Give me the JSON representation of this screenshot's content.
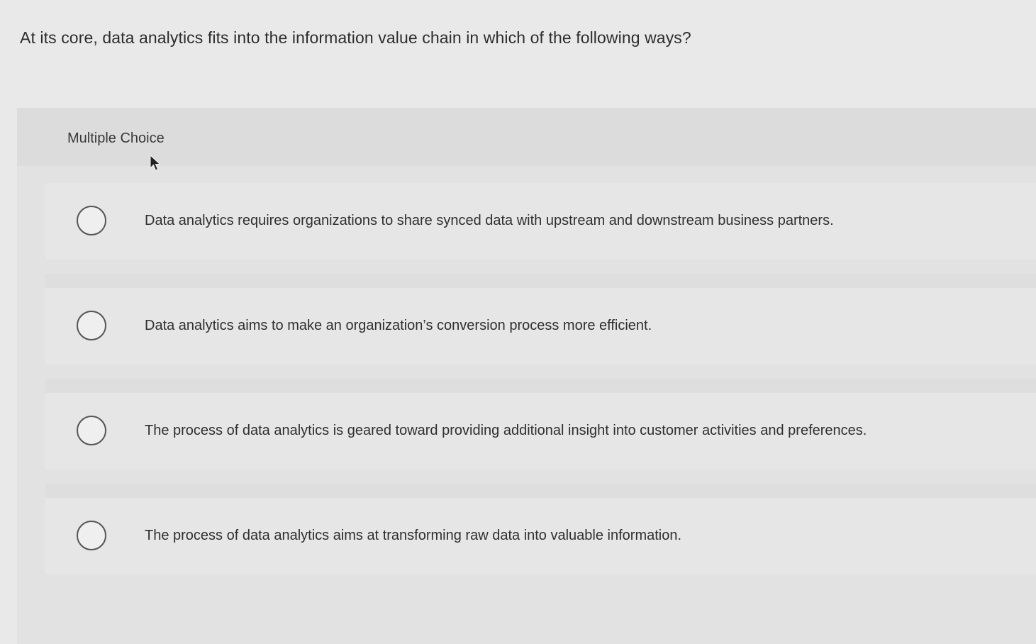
{
  "question": {
    "text": "At its core, data analytics fits into the information value chain in which of the following ways?"
  },
  "panel": {
    "label": "Multiple Choice",
    "cursor_icon": "mouse-pointer-icon"
  },
  "options": [
    {
      "text": "Data analytics requires organizations to share synced data with upstream and downstream business partners.",
      "selected": false
    },
    {
      "text": "Data analytics aims to make an organization’s conversion process more efficient.",
      "selected": false
    },
    {
      "text": "The process of data analytics is geared toward providing additional insight into customer activities and preferences.",
      "selected": false
    },
    {
      "text": "The process of data analytics aims at transforming raw data into valuable information.",
      "selected": false
    }
  ],
  "colors": {
    "page_bg": "#e9e9e9",
    "panel_bg": "#e2e2e2",
    "text": "#2d2d2d",
    "radio_border": "#555555"
  }
}
